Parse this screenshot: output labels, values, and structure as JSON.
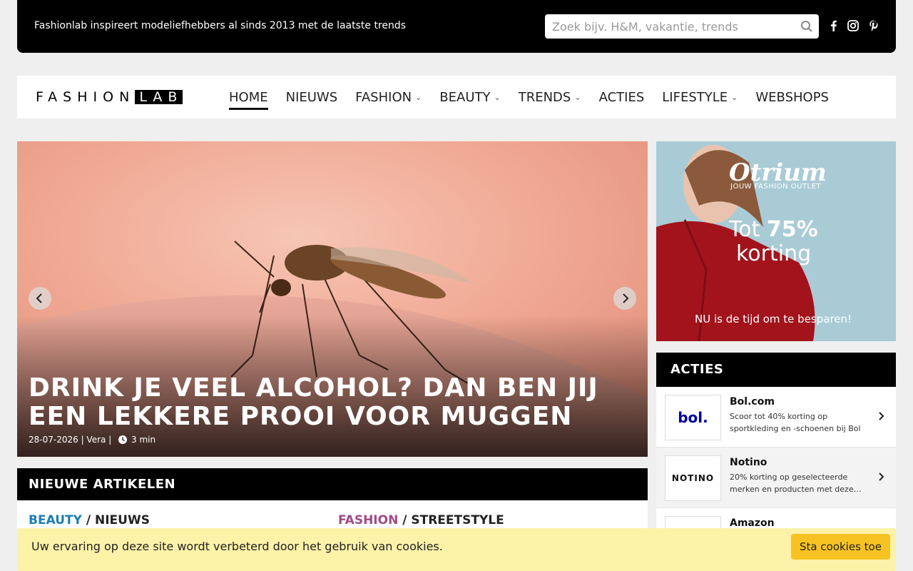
{
  "topbar": {
    "tagline": "Fashionlab inspireert modeliefhebbers al sinds 2013 met de laatste trends",
    "search_placeholder": "Zoek bijv. H&M, vakantie, trends",
    "social": [
      "facebook-icon",
      "instagram-icon",
      "pinterest-icon"
    ]
  },
  "logo": {
    "part1": "FASHION",
    "part2": "LAB"
  },
  "nav": {
    "items": [
      {
        "label": "HOME",
        "active": true,
        "dropdown": false
      },
      {
        "label": "NIEUWS",
        "active": false,
        "dropdown": false
      },
      {
        "label": "FASHION",
        "active": false,
        "dropdown": true
      },
      {
        "label": "BEAUTY",
        "active": false,
        "dropdown": true
      },
      {
        "label": "TRENDS",
        "active": false,
        "dropdown": true
      },
      {
        "label": "ACTIES",
        "active": false,
        "dropdown": false
      },
      {
        "label": "LIFESTYLE",
        "active": false,
        "dropdown": true
      },
      {
        "label": "WEBSHOPS",
        "active": false,
        "dropdown": false
      }
    ]
  },
  "hero": {
    "title": "DRINK JE VEEL ALCOHOL? DAN BEN JIJ EEN LEKKERE PROOI VOOR MUGGEN",
    "date": "28-07-2026",
    "author": "Vera",
    "read_time": "3 min"
  },
  "ad": {
    "brand": "Otrium",
    "subtitle": "JOUW FASHION OUTLET",
    "offer_line1_prefix": "Tot",
    "offer_line1_value": "75%",
    "offer_line2": "korting",
    "cta": "NU is de tijd om te besparen!"
  },
  "acties": {
    "heading": "ACTIES",
    "deals": [
      {
        "name": "Bol.com",
        "logo_text": "bol.",
        "desc": "Scoor tot 40% korting op sportkleding en -schoenen bij Bol"
      },
      {
        "name": "Notino",
        "logo_text": "NOTINO",
        "desc": "20% korting op geselecteerde merken en producten met deze…"
      },
      {
        "name": "Amazon",
        "logo_text": "",
        "desc": ""
      }
    ]
  },
  "articles": {
    "heading": "NIEUWE ARTIKELEN",
    "items": [
      {
        "category": "BEAUTY",
        "subcategory": "NIEUWS"
      },
      {
        "category": "FASHION",
        "subcategory": "STREETSTYLE"
      }
    ]
  },
  "cookie": {
    "message": "Uw ervaring op deze site wordt verbeterd door het gebruik van cookies.",
    "button": "Sta cookies toe"
  },
  "colors": {
    "beauty": "#1f7db3",
    "fashion": "#a04a86",
    "cookie_bg": "#fcf2a8",
    "cookie_button": "#f6c322"
  }
}
